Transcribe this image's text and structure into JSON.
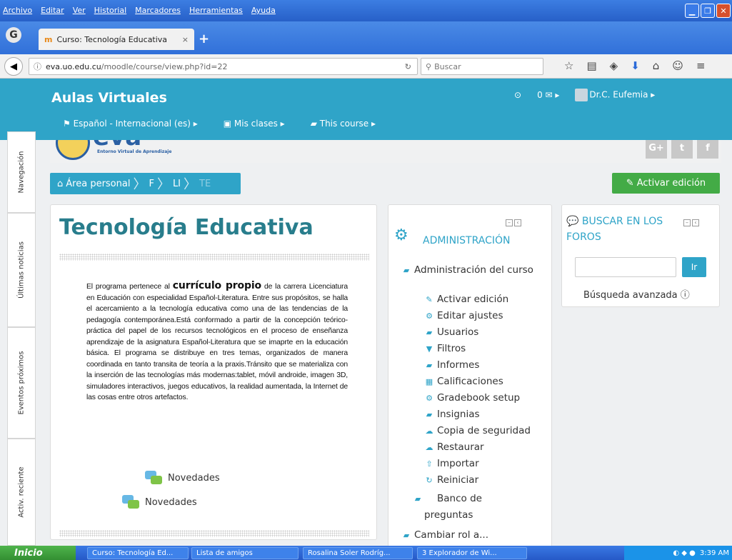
{
  "browser": {
    "menu": [
      "Archivo",
      "Editar",
      "Ver",
      "Historial",
      "Marcadores",
      "Herramientas",
      "Ayuda"
    ],
    "tab_title": "Curso: Tecnología Educativa",
    "tab_close": "×",
    "new_tab": "+",
    "url_host": "eva.uo.edu.cu",
    "url_path": "/moodle/course/view.php?id=22",
    "search_placeholder": "Buscar"
  },
  "moodle": {
    "site_title": "Aulas Virtuales",
    "messages": "0 ✉ ▸",
    "user": "Dr.C. Eufemia ▸",
    "custom_menu": [
      "Español - Internacional (es) ▸",
      "Mis clases ▸",
      "This course ▸"
    ],
    "logo_text": "eva",
    "logo_tagline": "Entorno Virtual de Aprendizaje",
    "social": [
      "G+",
      "t",
      "f"
    ],
    "side_tabs": [
      "Navegación",
      "Últimas noticias",
      "Eventos próximos",
      "Activ. reciente"
    ],
    "breadcrumb": [
      "Área personal",
      "F",
      "LI",
      "TE"
    ],
    "edit_button": "Activar edición",
    "course_title": "Tecnología Educativa",
    "summary_pre": "El programa pertenece al ",
    "summary_bold": "currículo propio",
    "summary_post": " de la carrera Licenciatura en Educación con especialidad Español-Literatura. Entre sus propósitos, se halla el acercamiento a la tecnología educativa como una de las tendencias de la pedagogía contemporánea.Está conformado a partir de la concepción teórico-práctica del papel de los recursos tecnológicos en el proceso de enseñanza aprendizaje de la asignatura Español-Literatura que se imaprte en la educación básica. El programa se distribuye en tres temas, organizados de manera coordinada en tanto transita de teoría a la praxis.Tránsito que se materializa con la inserción de las tecnologías más modernas:tablet, móvil androide, imagen 3D, simuladores interactivos, juegos educativos, la realidad aumentada, la Internet de las cosas entre otros artefactos.",
    "forum_1": "Novedades",
    "forum_2": "Novedades",
    "admin": {
      "title": "ADMINISTRACIÓN",
      "course_admin": "Administración del curso",
      "items": [
        "Activar edición",
        "Editar ajustes",
        "Usuarios",
        "Filtros",
        "Informes",
        "Calificaciones",
        "Gradebook setup",
        "Insignias",
        "Copia de seguridad",
        "Restaurar",
        "Importar",
        "Reiniciar",
        "Banco de preguntas",
        "Cambiar rol a..."
      ]
    },
    "search_forums": {
      "title": "BUSCAR EN LOS FOROS",
      "go": "Ir",
      "advanced": "Búsqueda avanzada"
    }
  },
  "taskbar": {
    "start": "Inicio",
    "tasks": [
      "Curso: Tecnología Ed...",
      "Lista de amigos",
      "Rosalina Soler Rodríg...",
      "3 Explorador de Wi..."
    ],
    "clock": "3:39 AM"
  }
}
